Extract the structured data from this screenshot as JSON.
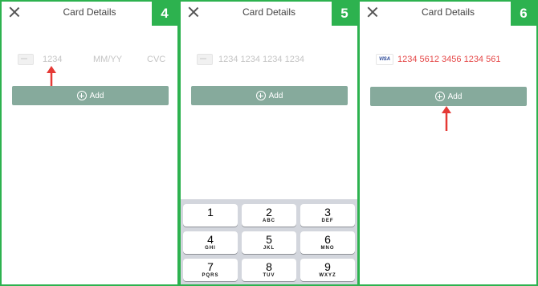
{
  "screen_title": "Card Details",
  "panels": [
    {
      "step": "4",
      "placeholders": {
        "card_number": "1234",
        "expiry": "MM/YY",
        "cvc": "CVC"
      },
      "add_label": "Add"
    },
    {
      "step": "5",
      "placeholders": {
        "card_number": "1234 1234 1234 1234"
      },
      "add_label": "Add",
      "keypad": [
        {
          "digit": "1",
          "letters": ""
        },
        {
          "digit": "2",
          "letters": "ABC"
        },
        {
          "digit": "3",
          "letters": "DEF"
        },
        {
          "digit": "4",
          "letters": "GHI"
        },
        {
          "digit": "5",
          "letters": "JKL"
        },
        {
          "digit": "6",
          "letters": "MNO"
        },
        {
          "digit": "7",
          "letters": "PQRS"
        },
        {
          "digit": "8",
          "letters": "TUV"
        },
        {
          "digit": "9",
          "letters": "WXYZ"
        }
      ]
    },
    {
      "step": "6",
      "card_brand": "VISA",
      "card_number_value": "1234 5612 3456 1234 561",
      "add_label": "Add"
    }
  ],
  "colors": {
    "frame_green": "#2db24f",
    "add_button": "#86aa9c",
    "arrow_red": "#e53935",
    "entered_text": "#e54848"
  }
}
